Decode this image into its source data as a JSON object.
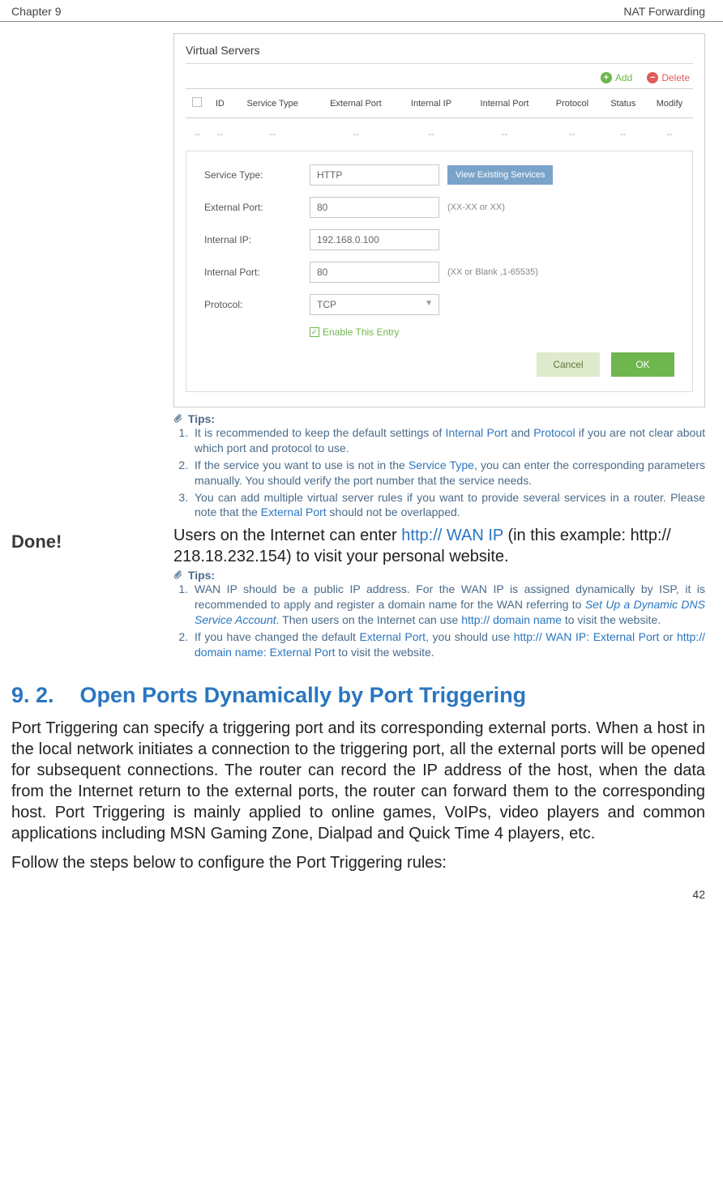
{
  "header": {
    "chapter": "Chapter 9",
    "topic": "NAT Forwarding"
  },
  "panel": {
    "title": "Virtual Servers",
    "add": "Add",
    "delete": "Delete",
    "columns": [
      "",
      "ID",
      "Service Type",
      "External Port",
      "Internal IP",
      "Internal Port",
      "Protocol",
      "Status",
      "Modify"
    ],
    "empty_row": [
      "--",
      "--",
      "--",
      "--",
      "--",
      "--",
      "--",
      "--",
      "--"
    ],
    "form": {
      "serviceTypeLabel": "Service Type:",
      "serviceTypeValue": "HTTP",
      "viewButton": "View Existing Services",
      "extPortLabel": "External Port:",
      "extPortValue": "80",
      "extPortHint": "(XX-XX or XX)",
      "intIPLabel": "Internal IP:",
      "intIPValue": "192.168.0.100",
      "intPortLabel": "Internal Port:",
      "intPortValue": "80",
      "intPortHint": "(XX or Blank ,1-65535)",
      "protocolLabel": "Protocol:",
      "protocolValue": "TCP",
      "enableLabel": "Enable This Entry",
      "cancel": "Cancel",
      "ok": "OK"
    }
  },
  "tips1": {
    "head": "Tips:",
    "item1_a": "It is recommended to keep the default settings of ",
    "item1_link1": "Internal Port",
    "item1_b": " and ",
    "item1_link2": "Protocol",
    "item1_c": " if you are not clear about which port and protocol to use.",
    "item2_a": "If the service you want to use is not in the ",
    "item2_link": "Service Type",
    "item2_b": ", you can enter the corresponding parameters manually. You should verify the port number that the service needs.",
    "item3_a": "You can add multiple virtual server rules if you want to provide several services in a router. Please note that the ",
    "item3_link": "External Port",
    "item3_b": " should not be overlapped."
  },
  "done": {
    "label": "Done!",
    "p_a": "Users on the Internet can enter ",
    "p_link": "http:// WAN IP",
    "p_b": " (in this example: http:// 218.18.232.154) to visit your personal website."
  },
  "tips2": {
    "head": "Tips:",
    "item1_a": "WAN IP should be a public IP address. For the WAN IP is assigned dynamically by ISP, it is recommended to apply and register a domain name for the WAN referring to ",
    "item1_i": "Set Up a Dynamic DNS Service Account",
    "item1_b": ". Then users on the Internet can use ",
    "item1_link": "http:// domain name",
    "item1_c": " to visit the website.",
    "item2_a": "If you have changed the default ",
    "item2_link1": "External Port",
    "item2_b": ", you should use ",
    "item2_link2": "http:// WAN IP: External Port",
    "item2_c": " or ",
    "item2_link3": "http:// domain name: External Port",
    "item2_d": " to visit the website."
  },
  "section": {
    "num": "9. 2.",
    "title": "Open Ports Dynamically by Port Triggering",
    "p1": "Port Triggering can specify a triggering port and its corresponding external ports. When a host in the local network initiates a connection to the triggering port, all the external ports will be opened for subsequent connections. The router can record the IP address of the host, when the data from the Internet return to the external ports, the router can forward them to the corresponding host. Port Triggering is mainly applied to online games, VoIPs, video players and common applications including MSN Gaming Zone, Dialpad and Quick Time 4 players, etc.",
    "p2": "Follow the steps below to configure the Port Triggering rules:"
  },
  "pageNumber": "42"
}
